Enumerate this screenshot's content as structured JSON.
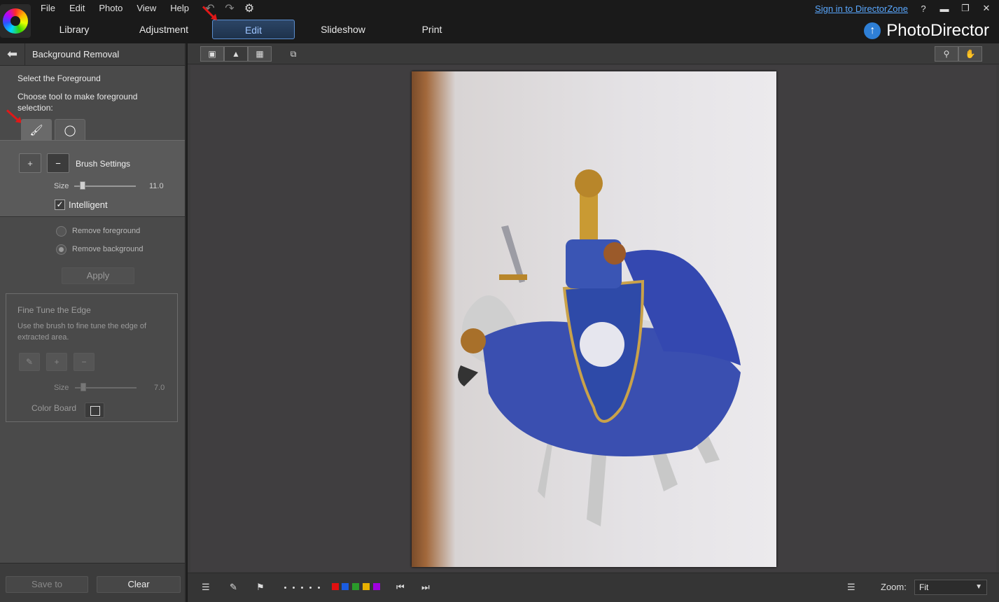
{
  "menu": {
    "file": "File",
    "edit": "Edit",
    "photo": "Photo",
    "view": "View",
    "help": "Help"
  },
  "modes": {
    "library": "Library",
    "adjustment": "Adjustment",
    "edit": "Edit",
    "slideshow": "Slideshow",
    "print": "Print",
    "active": "Edit"
  },
  "top_right": {
    "signin": "Sign in to DirectorZone",
    "help": "?",
    "brand": "PhotoDirector"
  },
  "panel": {
    "title": "Background Removal",
    "select_fg": "Select the Foreground",
    "choose_tool": "Choose tool to make foreground selection:",
    "brush_settings": "Brush Settings",
    "size_label": "Size",
    "size_value": "11.0",
    "size_fraction": 0.1,
    "intelligent_label": "Intelligent",
    "intelligent_checked": true,
    "remove_fg": "Remove foreground",
    "remove_bg": "Remove background",
    "selected_option": "Remove background",
    "apply": "Apply",
    "fine_title": "Fine Tune the Edge",
    "fine_desc": "Use the brush to fine tune the edge of extracted area.",
    "fine_size_label": "Size",
    "fine_size_value": "7.0",
    "fine_size_fraction": 0.1,
    "color_board": "Color Board",
    "save_to": "Save to",
    "clear": "Clear"
  },
  "statusbar": {
    "zoom_label": "Zoom:",
    "zoom_value": "Fit",
    "color_labels": [
      "#e01010",
      "#1a5ce0",
      "#2a9a2a",
      "#e8b000",
      "#a000e0"
    ]
  },
  "colors": {
    "accent": "#5aa8ff",
    "active_mode_text": "#9dc4ff",
    "annotation": "#e01818"
  }
}
